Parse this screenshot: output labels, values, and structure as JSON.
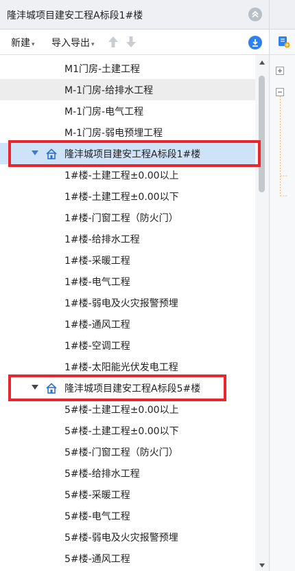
{
  "header": {
    "title": "隆沣城项目建安工程A标段1#楼"
  },
  "toolbar": {
    "new_label": "新建",
    "import_export_label": "导入导出"
  },
  "tree": {
    "items": [
      {
        "label": "M1门房-土建工程",
        "type": "child"
      },
      {
        "label": "M-1门房-给排水工程",
        "type": "child",
        "state": "hover"
      },
      {
        "label": "M-1门房-电气工程",
        "type": "child"
      },
      {
        "label": "M-1门房-弱电预埋工程",
        "type": "child"
      },
      {
        "label": "隆沣城项目建安工程A标段1#楼",
        "type": "parent",
        "state": "selected",
        "highlighted": true
      },
      {
        "label": "1#楼-土建工程±0.00以上",
        "type": "child"
      },
      {
        "label": "1#楼-土建工程±0.00以下",
        "type": "child"
      },
      {
        "label": "1#楼-门窗工程（防火门）",
        "type": "child"
      },
      {
        "label": "1#楼-给排水工程",
        "type": "child"
      },
      {
        "label": "1#楼-采暖工程",
        "type": "child"
      },
      {
        "label": "1#楼-电气工程",
        "type": "child"
      },
      {
        "label": "1#楼-弱电及火灾报警预埋",
        "type": "child"
      },
      {
        "label": "1#楼-通风工程",
        "type": "child"
      },
      {
        "label": "1#楼-空调工程",
        "type": "child"
      },
      {
        "label": "1#楼-太阳能光伏发电工程",
        "type": "child"
      },
      {
        "label": "隆沣城项目建安工程A标段5#楼",
        "type": "parent",
        "highlighted": true
      },
      {
        "label": "5#楼-土建工程±0.00以上",
        "type": "child"
      },
      {
        "label": "5#楼-土建工程±0.00以下",
        "type": "child"
      },
      {
        "label": "5#楼-门窗工程（防火门）",
        "type": "child"
      },
      {
        "label": "5#楼-给排水工程",
        "type": "child"
      },
      {
        "label": "5#楼-采暖工程",
        "type": "child"
      },
      {
        "label": "5#楼-电气工程",
        "type": "child"
      },
      {
        "label": "5#楼-弱电及火灾报警预埋",
        "type": "child"
      },
      {
        "label": "5#楼-通风工程",
        "type": "child"
      }
    ]
  },
  "colors": {
    "accent": "#2f80ed",
    "selected_row": "#cfe3f8",
    "highlight_box": "#e8262d"
  }
}
